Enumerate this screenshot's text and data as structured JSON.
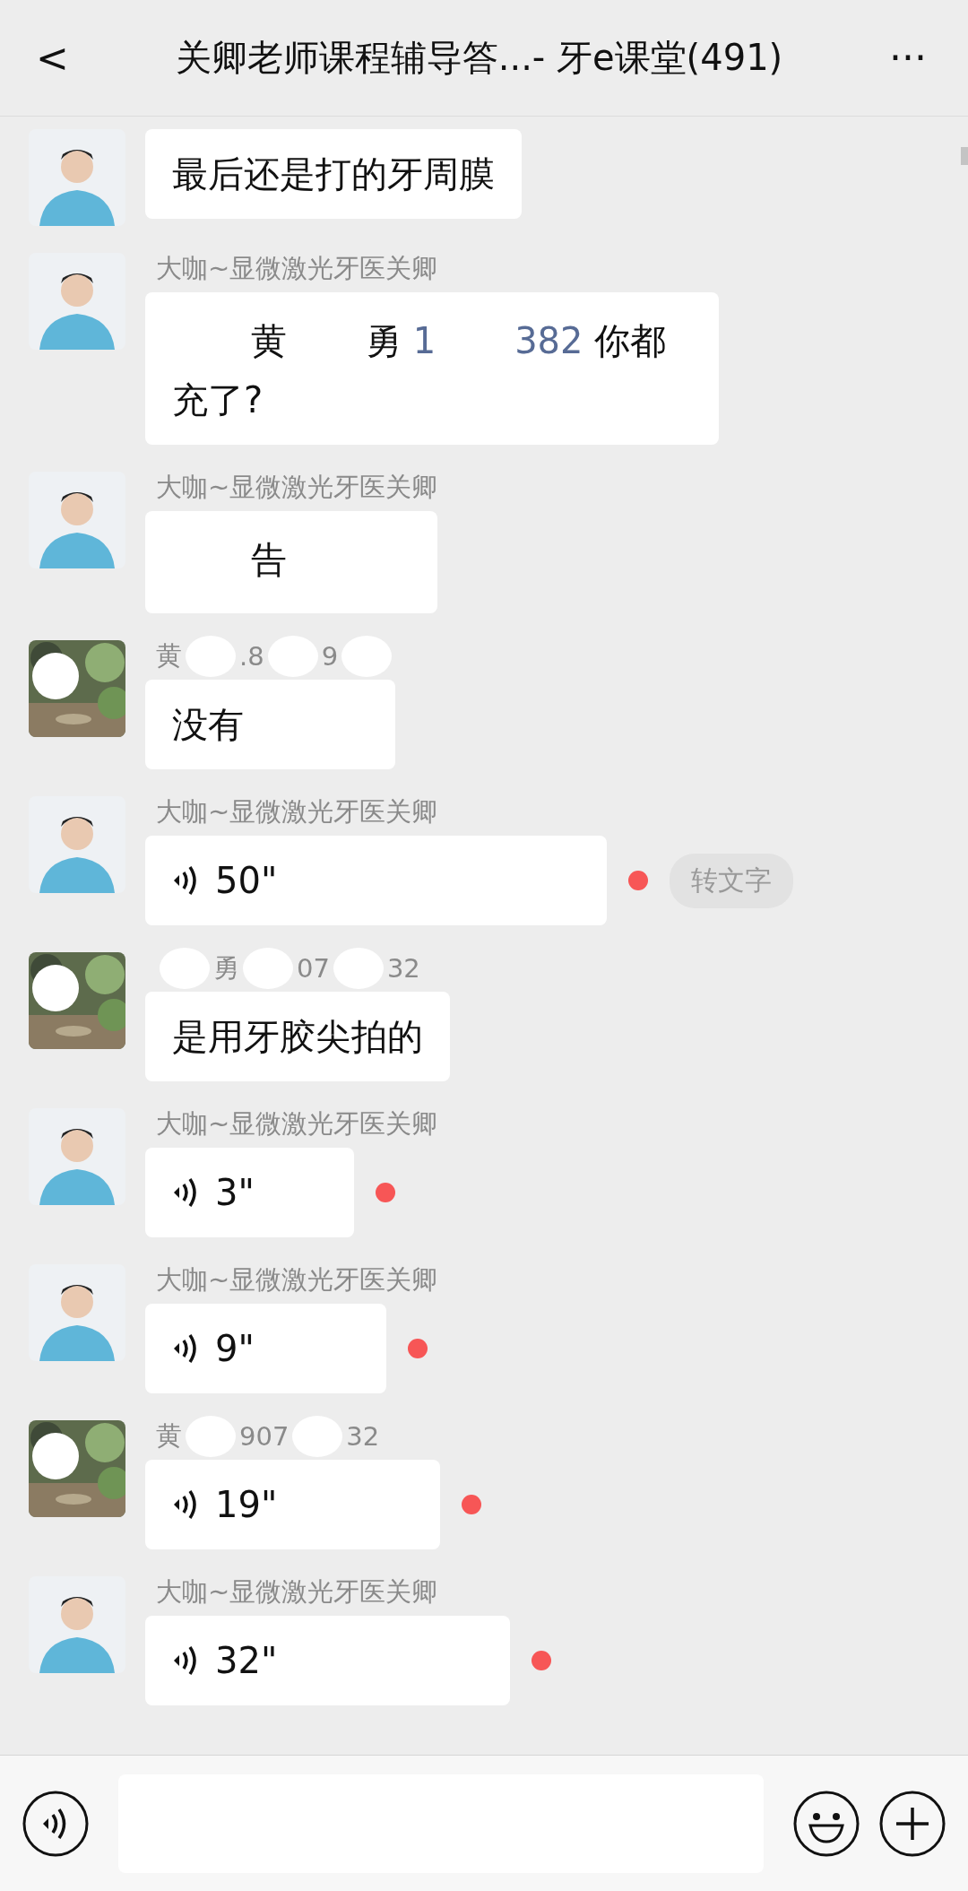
{
  "header": {
    "back": "<",
    "title": "关卿老师课程辅导答...- 牙e课堂(491)",
    "more": "···"
  },
  "messages": [
    {
      "sender": {
        "avatar": {
          "kind": "figure"
        }
      },
      "kind": "text",
      "segments": [
        {
          "kind": "text",
          "text": "最后还是打的牙周膜"
        }
      ]
    },
    {
      "sender": {
        "avatar": {
          "kind": "figure"
        },
        "name": [
          {
            "kind": "text",
            "text": "大咖~显微激光牙医关卿"
          }
        ]
      },
      "kind": "text",
      "segments": [
        {
          "kind": "redaction"
        },
        {
          "kind": "text",
          "text": "黄"
        },
        {
          "kind": "redaction"
        },
        {
          "kind": "text",
          "text": "勇 "
        },
        {
          "kind": "link",
          "text": "1"
        },
        {
          "kind": "redaction"
        },
        {
          "kind": "link",
          "text": "382"
        },
        {
          "kind": "text",
          "text": "  你都充了?"
        }
      ]
    },
    {
      "sender": {
        "avatar": {
          "kind": "figure"
        },
        "name": [
          {
            "kind": "text",
            "text": "大咖~显微激光牙医关卿"
          }
        ]
      },
      "kind": "text",
      "segments": [
        {
          "kind": "redaction"
        },
        {
          "kind": "text",
          "text": "告"
        },
        {
          "kind": "redaction"
        }
      ]
    },
    {
      "sender": {
        "name": [
          {
            "kind": "text",
            "text": "黄"
          },
          {
            "kind": "redaction"
          },
          {
            "kind": "text",
            "text": ".8"
          },
          {
            "kind": "redaction"
          },
          {
            "kind": "text",
            "text": "9"
          },
          {
            "kind": "redaction"
          }
        ]
      },
      "kind": "text",
      "segments": [
        {
          "kind": "text",
          "text": "没有"
        }
      ]
    },
    {
      "sender": {
        "avatar": {
          "kind": "figure"
        },
        "name": [
          {
            "kind": "text",
            "text": "大咖~显微激光牙医关卿"
          }
        ]
      },
      "kind": "voice",
      "duration": "50\"",
      "unread": true,
      "convert": "转文字"
    },
    {
      "sender": {
        "name": [
          {
            "kind": "redaction"
          },
          {
            "kind": "text",
            "text": "勇"
          },
          {
            "kind": "redaction"
          },
          {
            "kind": "text",
            "text": "07"
          },
          {
            "kind": "redaction"
          },
          {
            "kind": "text",
            "text": "32"
          }
        ]
      },
      "kind": "text",
      "segments": [
        {
          "kind": "text",
          "text": "是用牙胶尖拍的"
        }
      ]
    },
    {
      "sender": {
        "avatar": {
          "kind": "figure"
        },
        "name": [
          {
            "kind": "text",
            "text": "大咖~显微激光牙医关卿"
          }
        ]
      },
      "kind": "voice",
      "duration": "3\"",
      "unread": true
    },
    {
      "sender": {
        "avatar": {
          "kind": "figure"
        },
        "name": [
          {
            "kind": "text",
            "text": "大咖~显微激光牙医关卿"
          }
        ]
      },
      "kind": "voice",
      "duration": "9\"",
      "unread": true
    },
    {
      "sender": {
        "name": [
          {
            "kind": "text",
            "text": "黄"
          },
          {
            "kind": "redaction"
          },
          {
            "kind": "text",
            "text": "907"
          },
          {
            "kind": "redaction"
          },
          {
            "kind": "text",
            "text": "32"
          }
        ]
      },
      "kind": "voice",
      "duration": "19\"",
      "unread": true
    },
    {
      "sender": {
        "avatar": {
          "kind": "figure"
        },
        "name": [
          {
            "kind": "text",
            "text": "大咖~显微激光牙医关卿"
          }
        ]
      },
      "kind": "voice",
      "duration": "32\"",
      "unread": true
    }
  ]
}
